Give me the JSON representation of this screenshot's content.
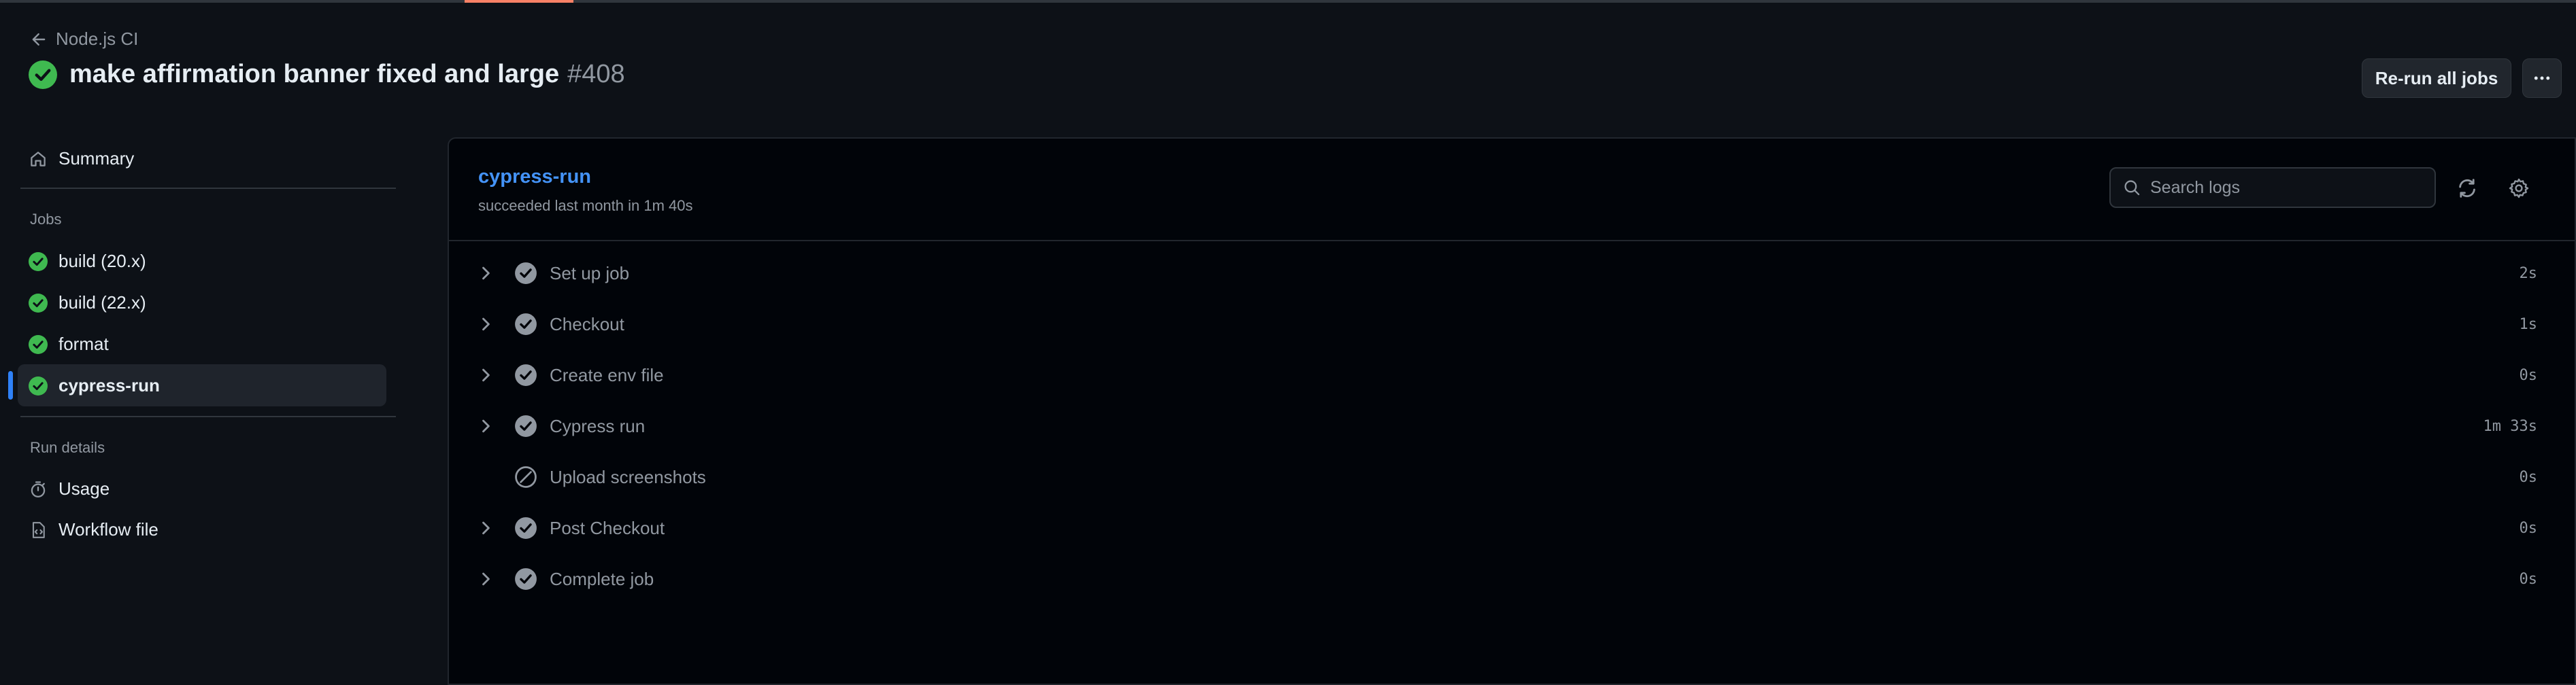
{
  "workflow": {
    "back_label": "Node.js CI"
  },
  "run": {
    "title": "make affirmation banner fixed and large",
    "number": "#408"
  },
  "actions": {
    "rerun_label": "Re-run all jobs",
    "more_icon": "kebab-horizontal-icon"
  },
  "sidebar": {
    "summary_label": "Summary",
    "jobs_heading": "Jobs",
    "jobs": [
      {
        "label": "build (20.x)",
        "status": "success"
      },
      {
        "label": "build (22.x)",
        "status": "success"
      },
      {
        "label": "format",
        "status": "success"
      },
      {
        "label": "cypress-run",
        "status": "success",
        "selected": true
      }
    ],
    "run_details_heading": "Run details",
    "details": [
      {
        "label": "Usage",
        "icon": "stopwatch-icon"
      },
      {
        "label": "Workflow file",
        "icon": "file-code-icon"
      }
    ]
  },
  "job": {
    "name": "cypress-run",
    "status_text": "succeeded last month in 1m 40s",
    "search_placeholder": "Search logs",
    "steps": [
      {
        "name": "Set up job",
        "duration": "2s",
        "status": "success",
        "expandable": true
      },
      {
        "name": "Checkout",
        "duration": "1s",
        "status": "success",
        "expandable": true
      },
      {
        "name": "Create env file",
        "duration": "0s",
        "status": "success",
        "expandable": true
      },
      {
        "name": "Cypress run",
        "duration": "1m 33s",
        "status": "success",
        "expandable": true
      },
      {
        "name": "Upload screenshots",
        "duration": "0s",
        "status": "skipped",
        "expandable": false
      },
      {
        "name": "Post Checkout",
        "duration": "0s",
        "status": "success",
        "expandable": true
      },
      {
        "name": "Complete job",
        "duration": "0s",
        "status": "success",
        "expandable": true
      }
    ]
  },
  "colors": {
    "success": "#3fb950",
    "accent": "#4493f8",
    "selected_bar": "#2f81f7",
    "progress_top": "#f78166"
  }
}
